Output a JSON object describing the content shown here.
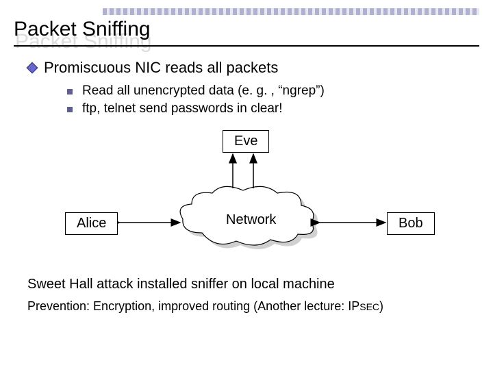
{
  "title": "Packet Sniffing",
  "bullets": {
    "lvl1": "Promiscuous NIC reads all packets",
    "lvl2a": "Read all unencrypted data (e. g. , “ngrep”)",
    "lvl2b": "ftp, telnet send passwords in clear!"
  },
  "diagram": {
    "eve": "Eve",
    "alice": "Alice",
    "bob": "Bob",
    "network": "Network"
  },
  "footer1": "Sweet Hall attack installed sniffer on local machine",
  "footer2_pre": "Prevention:  Encryption, improved routing (Another lecture: IP",
  "footer2_small": "SEC",
  "footer2_post": ")"
}
